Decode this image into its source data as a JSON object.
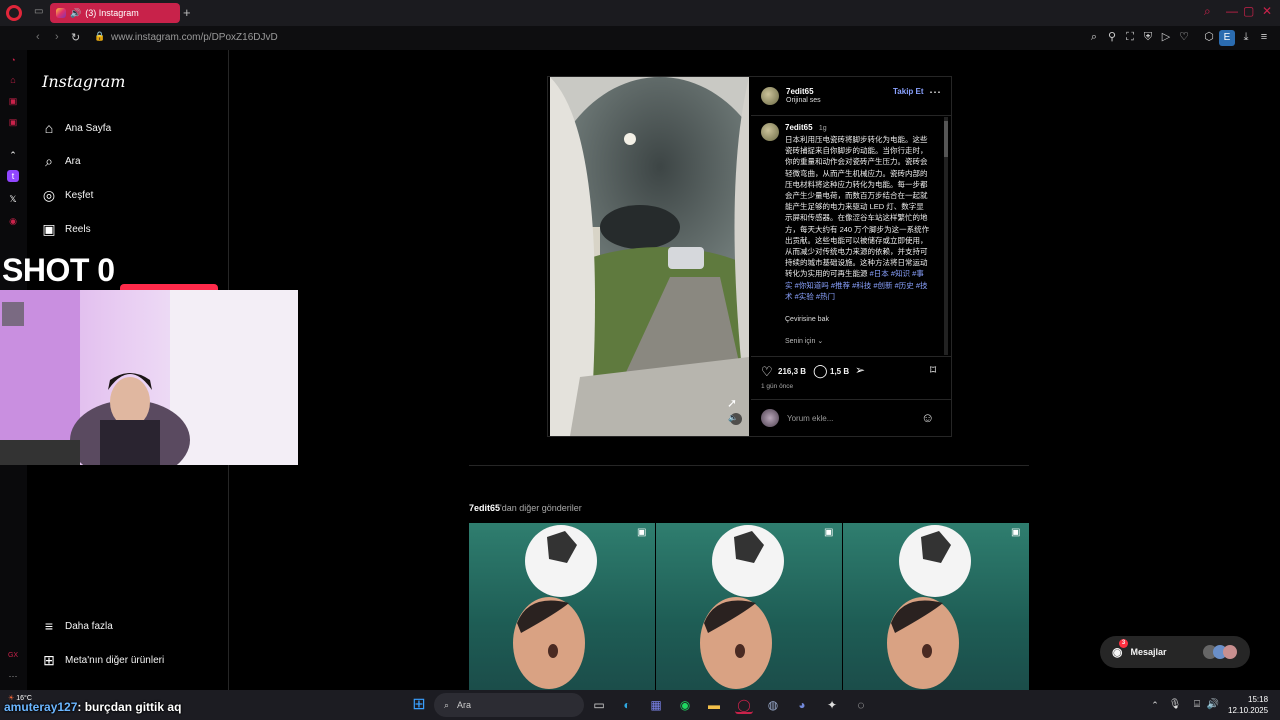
{
  "browser": {
    "tab_title": "(3) Instagram",
    "url": "www.instagram.com/p/DPoxZ16DJvD",
    "new_tab_icon": "plus-icon"
  },
  "instagram": {
    "logo": "Instagram",
    "nav": [
      {
        "label": "Ana Sayfa",
        "icon": "home-icon"
      },
      {
        "label": "Ara",
        "icon": "search-icon"
      },
      {
        "label": "Keşfet",
        "icon": "compass-icon"
      },
      {
        "label": "Reels",
        "icon": "reels-icon"
      }
    ],
    "nav_bottom": [
      {
        "label": "Daha fazla",
        "icon": "menu-icon"
      },
      {
        "label": "Meta'nın diğer ürünleri",
        "icon": "grid-icon"
      }
    ]
  },
  "post": {
    "author": "7edit65",
    "audio": "Orijinal ses",
    "follow_label": "Takip Et",
    "comment_author": "7edit65",
    "comment_age": "1g",
    "caption": "日本利用压电瓷砖将脚步转化为电能。这些瓷砖捕捉来自你脚步的动能。当你行走时，你的重量和动作会对瓷砖产生压力。瓷砖会轻微弯曲，从而产生机械应力。瓷砖内部的压电材料将这种应力转化为电能。每一步都会产生少量电荷，而数百万步结合在一起就能产生足够的电力来驱动 LED 灯、数字显示屏和传感器。在像涩谷车站这样繁忙的地方，每天大约有 240 万个脚步为这一系统作出贡献。这些电能可以被储存或立即使用，从而减少对传统电力来源的依赖，并支持可持续的城市基础设施。这种方法将日常运动转化为实用的可再生能源",
    "hashtags": "#日本 #知识 #事实 #你知道吗 #推荐 #科技 #创新 #历史 #技术 #实验 #热门",
    "translate": "Çevirisine bak",
    "for_you": "Senin için",
    "likes": "216,3 B",
    "comments": "1,5 B",
    "time": "1 gün önce",
    "comment_placeholder": "Yorum ekle..."
  },
  "more": {
    "user": "7edit65",
    "suffix": "'dan diğer gönderiler"
  },
  "messages": {
    "label": "Mesajlar",
    "badge": "3"
  },
  "overlay": {
    "shot_text": "SHOT 0",
    "chat_user": "amuteray127",
    "chat_message": ": burçdan gittik aq"
  },
  "taskbar": {
    "weather": "16°C",
    "search": "Ara",
    "time": "15:18",
    "date": "12.10.2025"
  },
  "colors": {
    "opera_red": "#c8224a",
    "ig_link": "#8aa2ff",
    "bg": "#000000"
  }
}
